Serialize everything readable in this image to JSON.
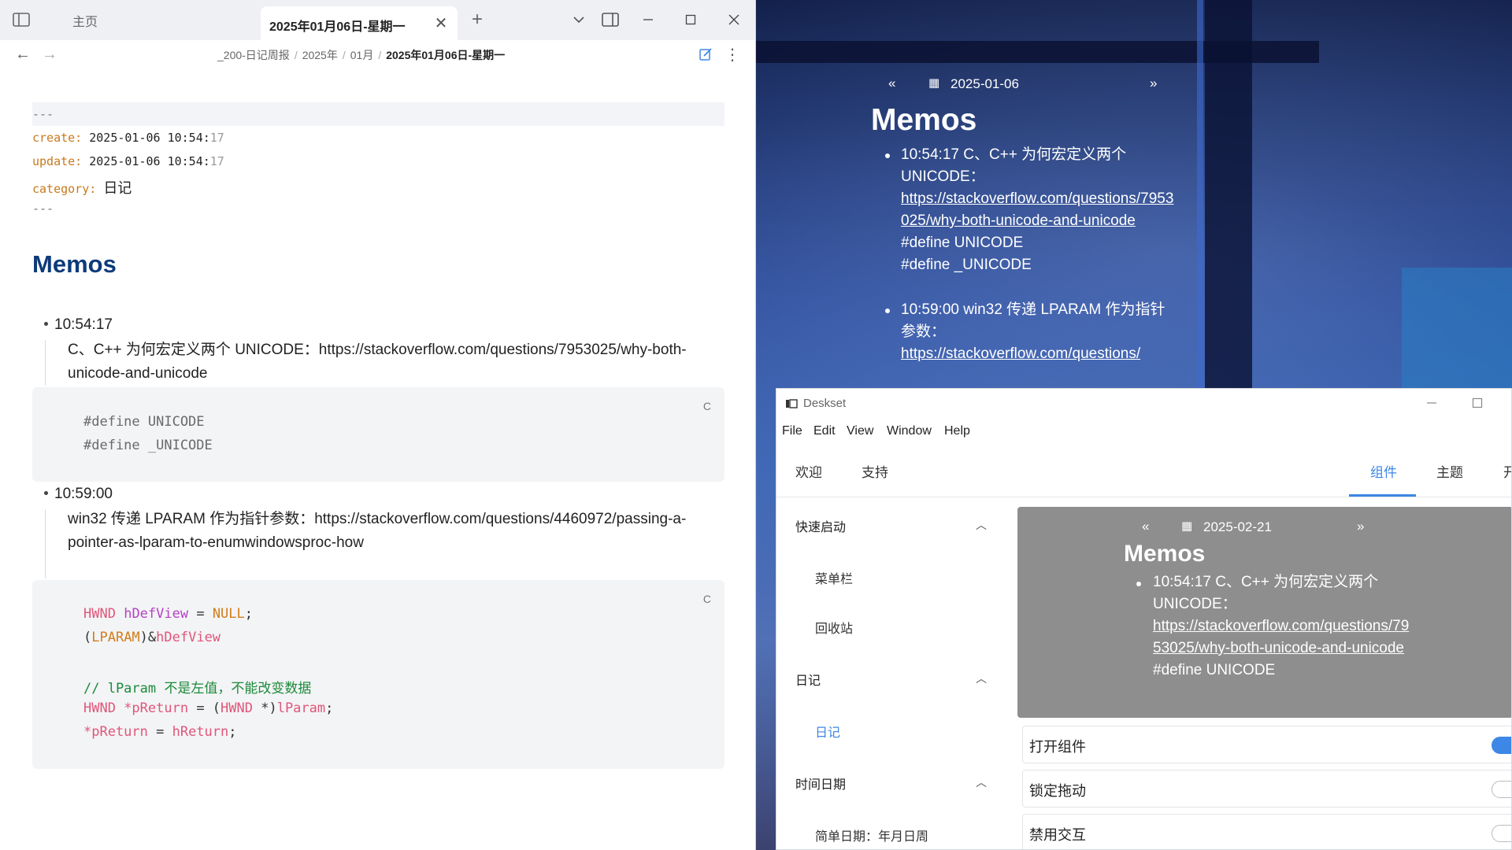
{
  "obsidian": {
    "tabs": {
      "home": "主页",
      "active": "2025年01月06日-星期一"
    },
    "breadcrumb": [
      "_200-日记周报",
      "2025年",
      "01月",
      "2025年01月06日-星期一"
    ],
    "frontmatter": {
      "fence": "---",
      "create_key": "create:",
      "create_val": "2025-01-06 10:54:",
      "create_sec": "17",
      "update_key": "update:",
      "update_val": "2025-01-06 10:54:",
      "update_sec": "17",
      "category_key": "category:",
      "category_val": "日记"
    },
    "heading": "Memos",
    "memo1": {
      "time": "10:54:17",
      "text": "C、C++ 为何宏定义两个 UNICODE：https://stackoverflow.com/questions/7953025/why-both-unicode-and-unicode",
      "lang": "C",
      "code": [
        "#define UNICODE",
        "#define _UNICODE"
      ]
    },
    "memo2": {
      "time": "10:59:00",
      "text": "win32 传递 LPARAM 作为指针参数：https://stackoverflow.com/questions/4460972/passing-a-pointer-as-lparam-to-enumwindowsproc-how",
      "lang": "C",
      "code": {
        "l1_type": "HWND",
        "l1_id": "hDefView",
        "l1_op": " = ",
        "l1_val": "NULL",
        "l1_end": ";",
        "l2_open": "(",
        "l2_type": "LPARAM",
        "l2_mid": ")&",
        "l2_id": "hDefView",
        "l3_comment": "// lParam 不是左值，不能改变数据",
        "l4_type": "HWND",
        "l4_id": " *pReturn",
        "l4_op": " = (",
        "l4_type2": "HWND",
        "l4_star": " *)",
        "l4_id2": "lParam",
        "l4_end": ";",
        "l5_id": "*pReturn",
        "l5_op": " = ",
        "l5_id2": "hReturn",
        "l5_end": ";"
      }
    }
  },
  "widget": {
    "date": "2025-01-06",
    "title": "Memos",
    "item1_text": "10:54:17 C、C++ 为何宏定义两个 UNICODE：",
    "item1_link": "https://stackoverflow.com/questions/7953025/why-both-unicode-and-unicode",
    "item1_code1": "#define UNICODE",
    "item1_code2": "#define _UNICODE",
    "item2_text": "10:59:00 win32 传递 LPARAM 作为指针参数：",
    "item2_link": "https://stackoverflow.com/questions/"
  },
  "deskset": {
    "title": "Deskset",
    "menu": [
      "File",
      "Edit",
      "View",
      "Window",
      "Help"
    ],
    "tabs_left": [
      "欢迎",
      "支持"
    ],
    "tabs_right": [
      "组件",
      "主题",
      "开"
    ],
    "sidebar": {
      "quick_launch": "快速启动",
      "menu_bar": "菜单栏",
      "recycle_bin": "回收站",
      "diary_group": "日记",
      "diary_item": "日记",
      "datetime_group": "时间日期",
      "simple_date": "简单日期：年月日周"
    },
    "preview": {
      "date": "2025-02-21",
      "title": "Memos",
      "item_text": "10:54:17 C、C++ 为何宏定义两个 UNICODE：",
      "item_link": "https://stackoverflow.com/questions/7953025/why-both-unicode-and-unicode",
      "item_code": "#define UNICODE"
    },
    "options": [
      {
        "label": "打开组件",
        "on": true
      },
      {
        "label": "锁定拖动",
        "on": false
      },
      {
        "label": "禁用交互",
        "on": false
      }
    ]
  },
  "colors": {
    "accent": "#3d87e6",
    "heading": "#0d3a7a",
    "yaml_key": "#c87a1e"
  }
}
